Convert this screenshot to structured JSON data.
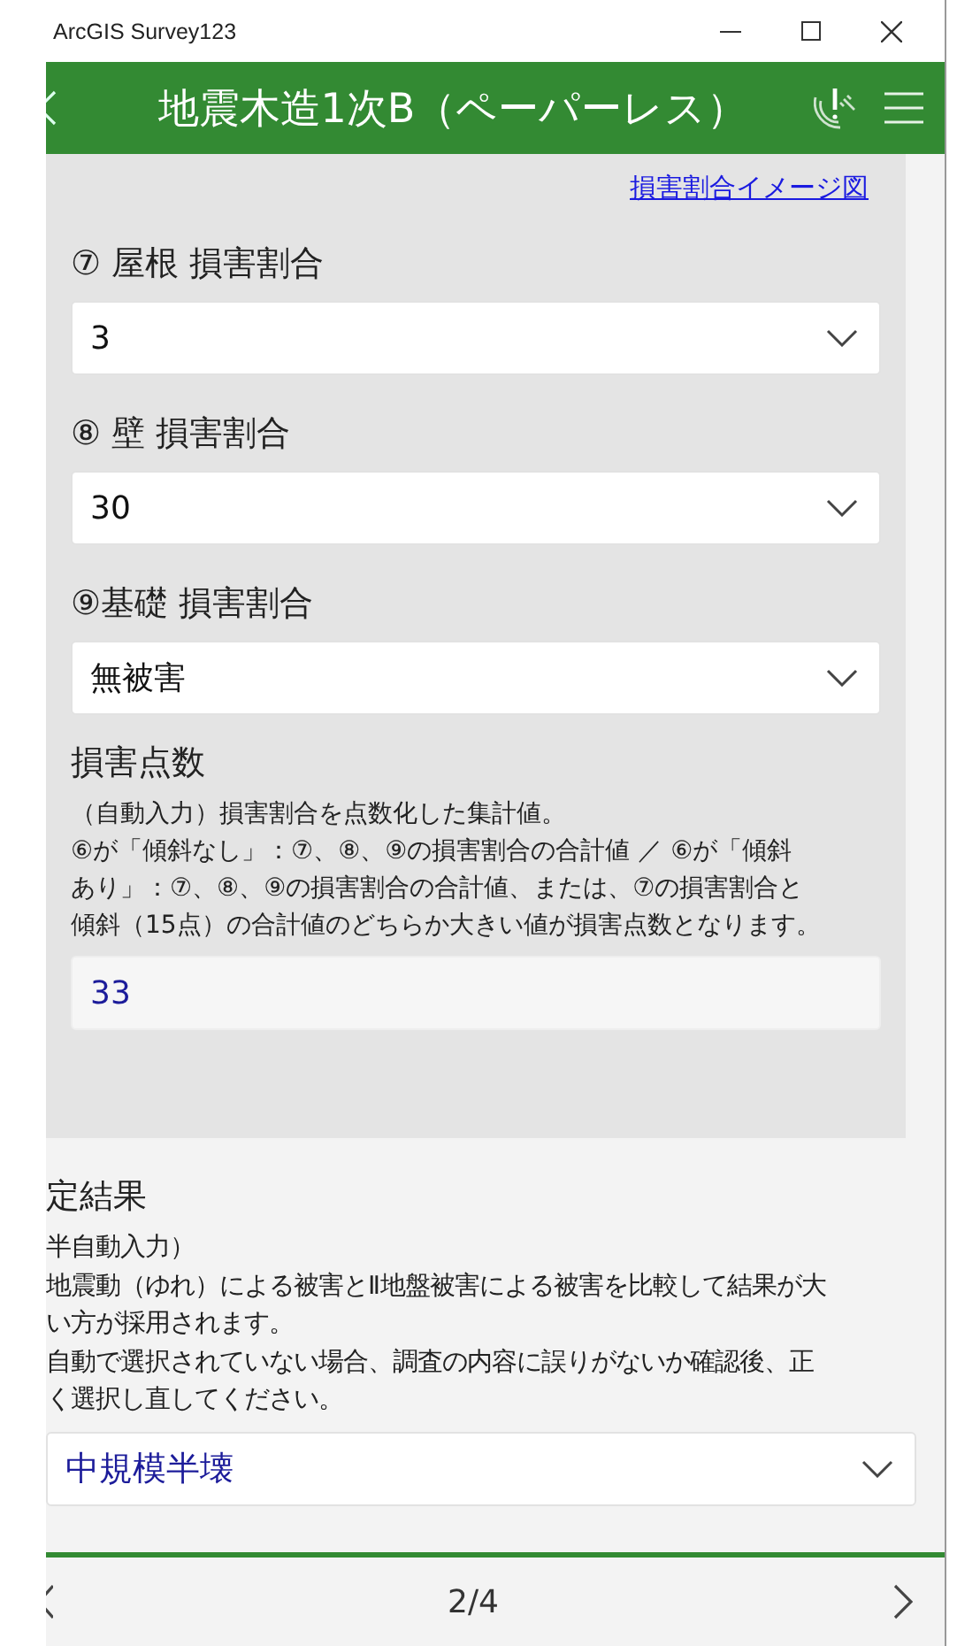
{
  "window": {
    "title": "ArcGIS Survey123"
  },
  "header": {
    "title": "地震木造1次B（ペーパーレス）"
  },
  "card": {
    "link": "損害割合イメージ図",
    "questions": [
      {
        "kind": "select",
        "label": "⑦ 屋根 損害割合",
        "value": "3",
        "calculated": false
      },
      {
        "kind": "select",
        "label": "⑧ 壁 損害割合",
        "value": "30",
        "calculated": false
      },
      {
        "kind": "select",
        "label": "⑨基礎 損害割合",
        "value": "無被害",
        "calculated": false
      },
      {
        "kind": "text",
        "label": "損害点数",
        "hint": [
          "（自動入力）損害割合を点数化した集計値。",
          "⑥が「傾斜なし」：⑦、⑧、⑨の損害割合の合計値 ／ ⑥が「傾斜",
          "あり」：⑦、⑧、⑨の損害割合の合計値、または、⑦の損害割合と",
          "傾斜（15点）の合計値のどちらか大きい値が損害点数となります。"
        ],
        "value": "33",
        "calculated": true
      }
    ]
  },
  "result": {
    "kind": "select",
    "label": "定結果",
    "hint": [
      "半自動入力）",
      "地震動（ゆれ）による被害とⅡ地盤被害による被害を比較して結果が大",
      "い方が採用されます。",
      "自動で選択されていない場合、調査の内容に誤りがないか確認後、正",
      "く選択し直してください。"
    ],
    "value": "中規模半壊",
    "calculated": true
  },
  "footer": {
    "page": "2/4"
  }
}
